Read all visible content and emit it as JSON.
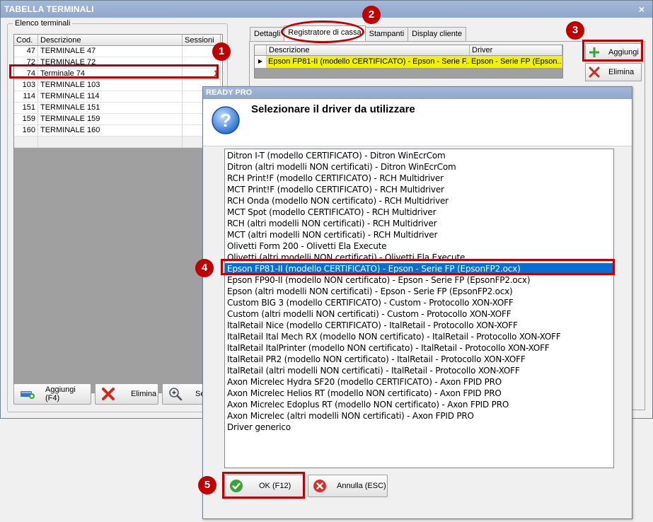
{
  "main_window": {
    "title": "TABELLA TERMINALI",
    "close_glyph": "×"
  },
  "terminals": {
    "group_label": "Elenco terminali",
    "columns": [
      "Cod.",
      "Descrizione",
      "Sessioni"
    ],
    "rows": [
      {
        "cod": "47",
        "desc": "TERMINALE 47",
        "sessioni": ""
      },
      {
        "cod": "72",
        "desc": "TERMINALE 72",
        "sessioni": ""
      },
      {
        "cod": "74",
        "desc": "Terminale 74",
        "sessioni": "1"
      },
      {
        "cod": "103",
        "desc": "TERMINALE 103",
        "sessioni": ""
      },
      {
        "cod": "114",
        "desc": "TERMINALE 114",
        "sessioni": ""
      },
      {
        "cod": "151",
        "desc": "TERMINALE 151",
        "sessioni": ""
      },
      {
        "cod": "159",
        "desc": "TERMINALE 159",
        "sessioni": ""
      },
      {
        "cod": "160",
        "desc": "TERMINALE 160",
        "sessioni": ""
      }
    ],
    "buttons": {
      "add": "Aggiungi (F4)",
      "delete": "Elimina",
      "search": "Se"
    }
  },
  "tabs": [
    "Dettagli",
    "Registratore di cassa",
    "Stampanti",
    "Display cliente"
  ],
  "active_tab": "Registratore di cassa",
  "driver_grid": {
    "columns": [
      "Descrizione",
      "Driver"
    ],
    "row": {
      "indicator": "▶",
      "desc": "Epson FP81-II (modello CERTIFICATO) - Epson - Serie F...",
      "driver": "Epson - Serie FP (Epson..."
    }
  },
  "right_buttons": {
    "add": "Aggiungi",
    "delete": "Elimina"
  },
  "dialog": {
    "title": "READY PRO",
    "heading": "Selezionare il driver da utilizzare",
    "drivers": [
      "Ditron I-T (modello CERTIFICATO) - Ditron WinEcrCom",
      "Ditron (altri modelli NON certificati) - Ditron WinEcrCom",
      "RCH Print!F (modello CERTIFICATO) - RCH Multidriver",
      "MCT Print!F (modello CERTIFICATO) - RCH Multidriver",
      "RCH Onda (modello NON certificato) - RCH Multidriver",
      "MCT Spot (modello CERTIFICATO) - RCH Multidriver",
      "RCH (altri modelli NON certificati) - RCH Multidriver",
      "MCT (altri modelli NON certificati) - RCH Multidriver",
      "Olivetti Form 200 - Olivetti Ela Execute",
      "Olivetti (altri modelli NON certificati) - Olivetti Ela Execute",
      "Epson FP81-II (modello CERTIFICATO) - Epson - Serie FP (EpsonFP2.ocx)",
      "Epson FP90-II (modello NON certificato) - Epson - Serie FP (EpsonFP2.ocx)",
      "Epson (altri modelli NON certificati) - Epson - Serie FP (EpsonFP2.ocx)",
      "Custom BIG 3 (modello CERTIFICATO) - Custom - Protocollo XON-XOFF",
      "Custom (altri modelli NON certificati) - Custom - Protocollo XON-XOFF",
      "ItalRetail Nice (modello CERTIFICATO) - ItalRetail - Protocollo XON-XOFF",
      "ItalRetail Ital Mech RX (modello NON certificato) - ItalRetail - Protocollo XON-XOFF",
      "ItalRetail ItalPrinter (modello NON certificato) - ItalRetail - Protocollo XON-XOFF",
      "ItalRetail PR2 (modello NON certificato) - ItalRetail - Protocollo XON-XOFF",
      "ItalRetail (altri modelli NON certificati) - ItalRetail - Protocollo XON-XOFF",
      "Axon Micrelec Hydra SF20 (modello CERTIFICATO) - Axon FPID PRO",
      "Axon Micrelec Helios RT (modello NON certificato) - Axon FPID PRO",
      "Axon Micrelec Edoplus RT (modello NON certificato) - Axon FPID PRO",
      "Axon Micrelec (altri modelli NON certificati) - Axon FPID PRO",
      "Driver generico"
    ],
    "selected_index": 10,
    "ok_label": "OK (F12)",
    "cancel_label": "Annulla (ESC)"
  },
  "annotations": [
    "1",
    "2",
    "3",
    "4",
    "5"
  ],
  "colors": {
    "accent_red": "#c00000",
    "selection_blue": "#0a6ed1",
    "row_highlight_yellow": "#f2f200",
    "titlebar_blue": "#8fa7cc"
  },
  "icons": {
    "add_terminal": "add-terminal-icon",
    "delete": "delete-x-icon",
    "search": "search-zoom-icon",
    "add": "plus-icon",
    "help": "question-icon",
    "ok": "check-icon",
    "cancel": "cancel-x-icon"
  }
}
